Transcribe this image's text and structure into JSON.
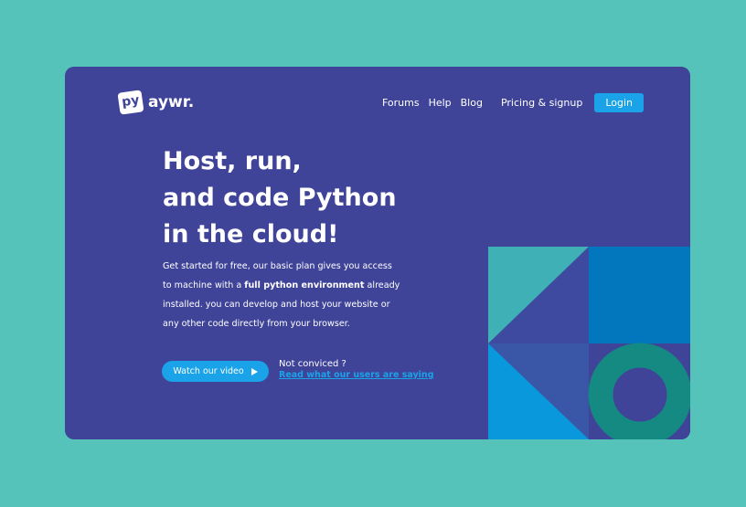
{
  "logo": {
    "badge": "py",
    "name": "aywr."
  },
  "nav": {
    "items": [
      "Forums",
      "Help",
      "Blog",
      "Pricing & signup"
    ],
    "login": "Login"
  },
  "hero": {
    "headline": [
      "Host, run,",
      "and code Python",
      "in the cloud!"
    ],
    "desc_before": "Get started for free, our basic plan gives you access to machine with a ",
    "desc_bold": "full python environment",
    "desc_after": " already installed. you can develop and host your website or any other code directly from your browser.",
    "watch_label": "Watch our video",
    "not_convinced": "Not conviced ?",
    "read_link": "Read what our users are saying"
  },
  "colors": {
    "page_bg": "#56c3ba",
    "card_bg": "#3f4499",
    "accent": "#1aa3e8",
    "teal_shape": "#3fb0b5",
    "blue_shape": "#0277bd",
    "green_ring": "#148a82"
  },
  "icons": {
    "watch": "play-icon"
  }
}
